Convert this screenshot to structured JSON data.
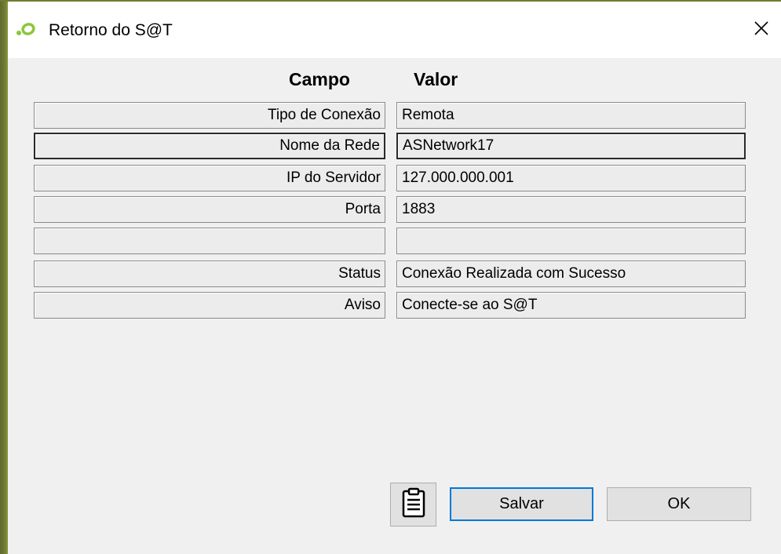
{
  "window": {
    "title": "Retorno do S@T",
    "app_icon": "sat-logo-icon",
    "close_icon": "close-icon",
    "close_glyph": "✕",
    "accent_color": "#6f7c35"
  },
  "table": {
    "header_field": "Campo",
    "header_value": "Valor",
    "rows": [
      {
        "field": "Tipo de Conexão",
        "value": "Remota"
      },
      {
        "field": "Nome da Rede",
        "value": "ASNetwork17"
      },
      {
        "field": "IP do Servidor",
        "value": "127.000.000.001"
      },
      {
        "field": "Porta",
        "value": "1883"
      },
      {
        "field": "",
        "value": ""
      },
      {
        "field": "Status",
        "value": "Conexão Realizada com Sucesso"
      },
      {
        "field": "Aviso",
        "value": "Conecte-se ao S@T"
      }
    ]
  },
  "footer": {
    "clipboard_icon": "clipboard-icon",
    "save_label": "Salvar",
    "ok_label": "OK"
  }
}
